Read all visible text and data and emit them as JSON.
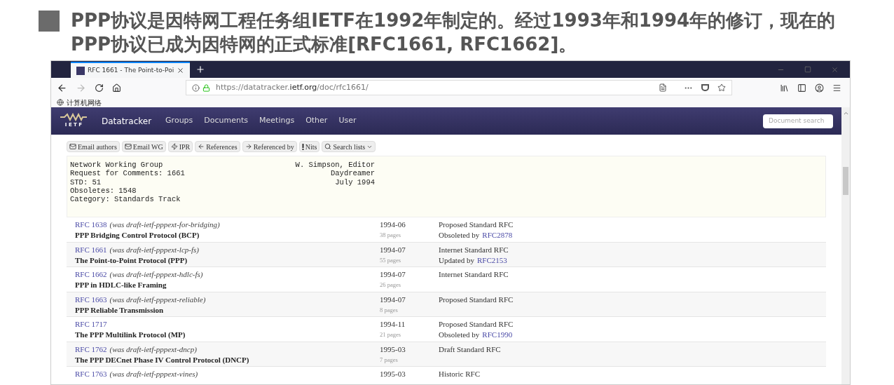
{
  "slide": {
    "heading": "PPP协议是因特网工程任务组IETF在1992年制定的。经过1993年和1994年的修订，现在的PPP协议已成为因特网的正式标准[RFC1661, RFC1662]。"
  },
  "browser": {
    "tab_title": "RFC 1661 - The Point-to-Poi",
    "url_prefix": "https://datatracker.",
    "url_domain": "ietf.org",
    "url_path": "/doc/rfc1661/",
    "bookmark": "计算机网络"
  },
  "site": {
    "logo_text": "I E T F",
    "brand": "Datatracker",
    "nav": [
      "Groups",
      "Documents",
      "Meetings",
      "Other",
      "User"
    ],
    "search_placeholder": "Document search"
  },
  "actions": [
    {
      "kind": "mail",
      "label": "Email authors"
    },
    {
      "kind": "mail",
      "label": "Email WG"
    },
    {
      "kind": "bolt",
      "label": "IPR"
    },
    {
      "kind": "left",
      "label": "References"
    },
    {
      "kind": "right",
      "label": "Referenced by"
    },
    {
      "kind": "bang",
      "label": "Nits"
    },
    {
      "kind": "search",
      "label": "Search lists",
      "caret": true
    }
  ],
  "header_left": [
    "Network Working Group",
    "Request for Comments: 1661",
    "STD: 51",
    "Obsoletes: 1548",
    "Category: Standards Track"
  ],
  "header_right": [
    "W. Simpson, Editor",
    "Daydreamer",
    "July 1994"
  ],
  "rows": [
    {
      "rfc": "RFC 1638",
      "draft": "(was draft-ietf-pppext-for-bridging)",
      "title": "PPP Bridging Control Protocol (BCP)",
      "date": "1994-06",
      "pages": "38 pages",
      "status": "Proposed Standard RFC",
      "note": "Obsoleted by",
      "note_link": "RFC2878"
    },
    {
      "rfc": "RFC 1661",
      "draft": "(was draft-ietf-pppext-lcp-fs)",
      "title": "The Point-to-Point Protocol (PPP)",
      "date": "1994-07",
      "pages": "55 pages",
      "status": "Internet Standard RFC",
      "note": "Updated by",
      "note_link": "RFC2153"
    },
    {
      "rfc": "RFC 1662",
      "draft": "(was draft-ietf-pppext-hdlc-fs)",
      "title": "PPP in HDLC-like Framing",
      "date": "1994-07",
      "pages": "26 pages",
      "status": "Internet Standard RFC"
    },
    {
      "rfc": "RFC 1663",
      "draft": "(was draft-ietf-pppext-reliable)",
      "title": "PPP Reliable Transmission",
      "date": "1994-07",
      "pages": "8 pages",
      "status": "Proposed Standard RFC"
    },
    {
      "rfc": "RFC 1717",
      "title": "The PPP Multilink Protocol (MP)",
      "date": "1994-11",
      "pages": "21 pages",
      "status": "Proposed Standard RFC",
      "note": "Obsoleted by",
      "note_link": "RFC1990"
    },
    {
      "rfc": "RFC 1762",
      "draft": "(was draft-ietf-pppext-dncp)",
      "title": "The PPP DECnet Phase IV Control Protocol (DNCP)",
      "date": "1995-03",
      "pages": "7 pages",
      "status": "Draft Standard RFC"
    },
    {
      "rfc": "RFC 1763",
      "draft": "(was draft-ietf-pppext-vines)",
      "date": "1995-03",
      "status": "Historic RFC"
    }
  ]
}
